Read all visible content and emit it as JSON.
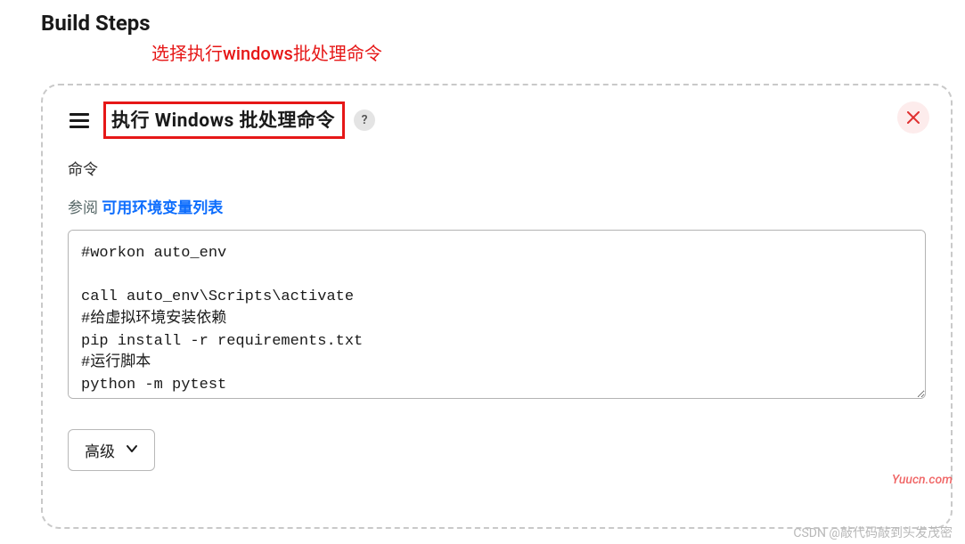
{
  "header": {
    "title": "Build Steps",
    "annotation": "选择执行windows批处理命令"
  },
  "step": {
    "title": "执行 Windows 批处理命令",
    "help": "?",
    "command_label": "命令",
    "hint_prefix": "参阅 ",
    "hint_link": "可用环境变量列表",
    "script": "#workon auto_env\n\ncall auto_env\\Scripts\\activate\n#给虚拟环境安装依赖\npip install -r requirements.txt\n#运行脚本\npython -m pytest",
    "advanced_label": "高级"
  },
  "watermarks": {
    "site": "Yuucn.com",
    "credit": "CSDN @敲代码敲到头发茂密"
  }
}
